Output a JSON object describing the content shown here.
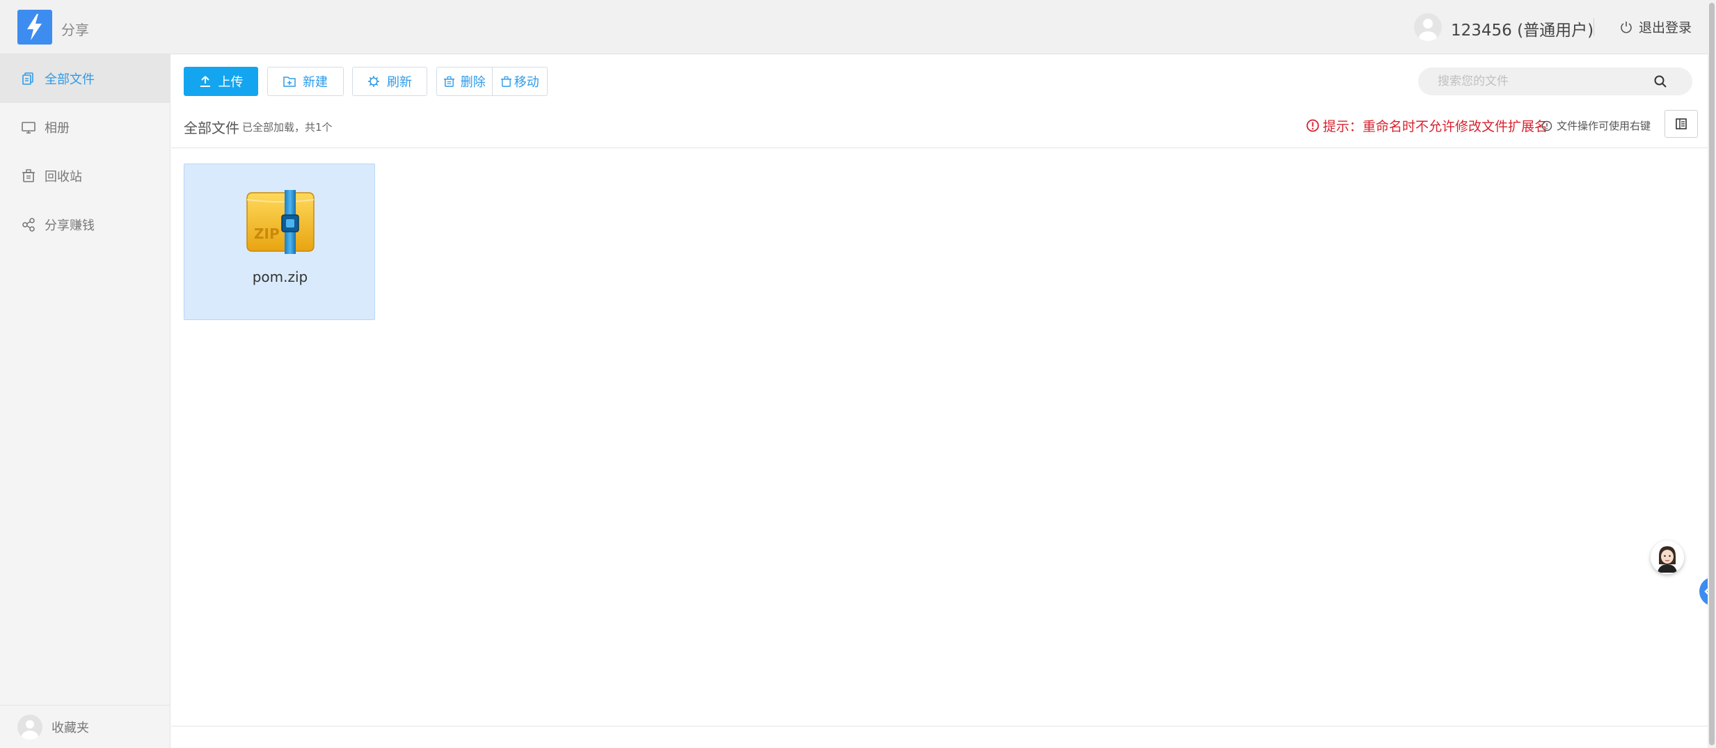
{
  "header": {
    "app_title": "分享",
    "user_name": "123456 (普通用户)",
    "logout_label": "退出登录"
  },
  "sidebar": {
    "items": [
      {
        "label": "全部文件",
        "icon": "files-icon",
        "active": true
      },
      {
        "label": "相册",
        "icon": "monitor-icon",
        "active": false
      },
      {
        "label": "回收站",
        "icon": "trash-icon",
        "active": false
      },
      {
        "label": "分享赚钱",
        "icon": "share-icon",
        "active": false
      }
    ],
    "favorites_label": "收藏夹"
  },
  "toolbar": {
    "upload_label": "上传",
    "new_label": "新建",
    "refresh_label": "刷新",
    "delete_label": "删除",
    "move_label": "移动"
  },
  "search": {
    "placeholder": "搜索您的文件",
    "value": ""
  },
  "info_bar": {
    "breadcrumb": "全部文件",
    "load_status": "已全部加载，共1个",
    "tip": "提示：重命名时不允许修改文件扩展名",
    "hint": "文件操作可使用右键"
  },
  "files": [
    {
      "name": "pom.zip",
      "type": "zip",
      "selected": true
    }
  ],
  "colors": {
    "accent": "#14a5f0",
    "link": "#2d9be9",
    "warning": "#d8222f",
    "selection": "#d9eafc",
    "logo": "#3d8cf0"
  }
}
